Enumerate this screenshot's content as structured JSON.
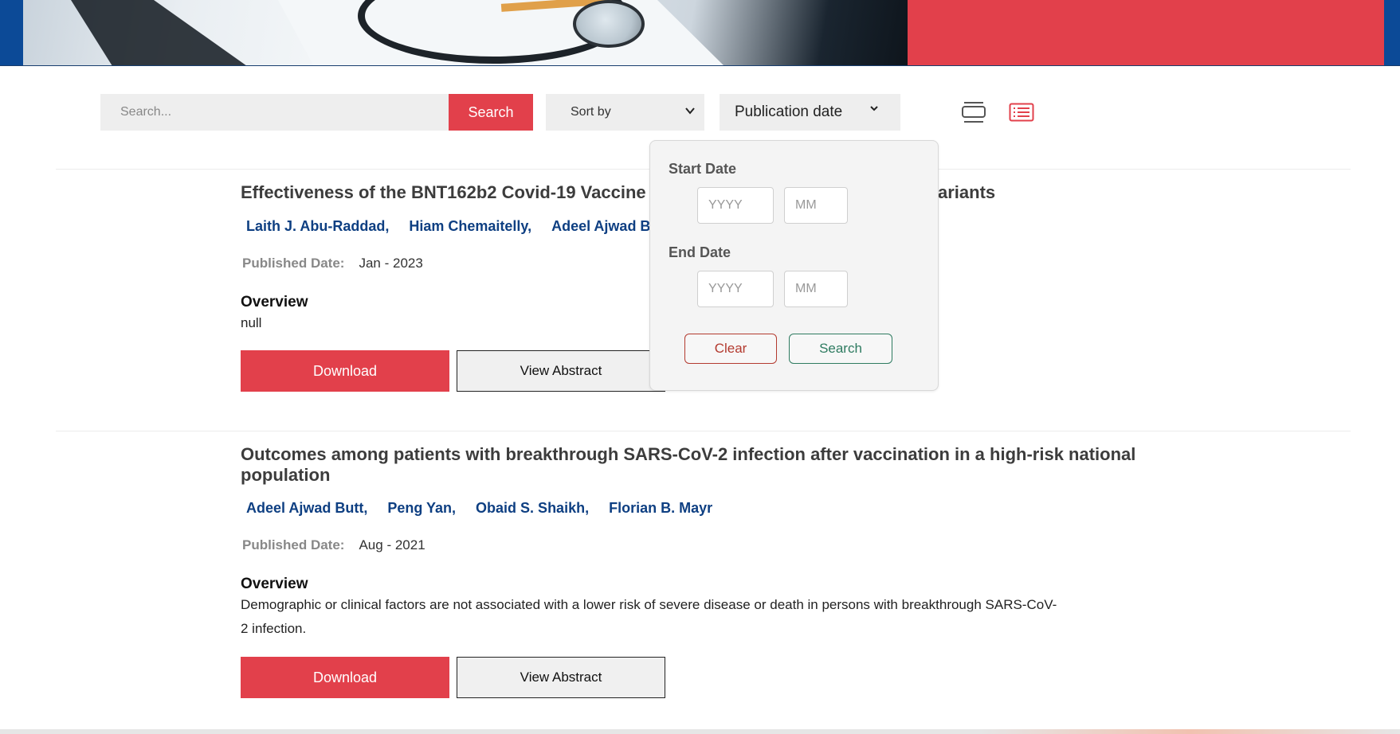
{
  "toolbar": {
    "search_placeholder": "Search...",
    "search_button": "Search",
    "sort_label": "Sort by",
    "publication_date_label": "Publication date"
  },
  "date_filter": {
    "start_label": "Start Date",
    "end_label": "End Date",
    "year_placeholder": "YYYY",
    "month_placeholder": "MM",
    "clear_label": "Clear",
    "search_label": "Search"
  },
  "articles": [
    {
      "title_visible_left": "Effectiveness of the BNT162b2 Covid-19 Vaccine",
      "title_visible_right": "ariants",
      "authors": [
        "Laith J. Abu-Raddad,",
        "Hiam Chemaitelly,",
        "Adeel Ajwad Bu"
      ],
      "published_label": "Published Date:",
      "published_value": "Jan - 2023",
      "overview_label": "Overview",
      "overview_text": "null",
      "download_label": "Download",
      "abstract_label": "View Abstract"
    },
    {
      "title_line1": "Outcomes among patients with breakthrough SARS-CoV-2 infection after vaccination in a high-risk national",
      "title_line2": "population",
      "authors": [
        "Adeel Ajwad Butt,",
        "Peng Yan,",
        "Obaid S. Shaikh,",
        "Florian B. Mayr"
      ],
      "published_label": "Published Date:",
      "published_value": "Aug - 2021",
      "overview_label": "Overview",
      "overview_line1": "Demographic or clinical factors are not associated with a lower risk of severe disease or death in persons with breakthrough SARS-CoV-",
      "overview_line2": "2 infection.",
      "download_label": "Download",
      "abstract_label": "View Abstract"
    }
  ],
  "colors": {
    "accent_red": "#e2404b",
    "author_blue": "#0e3f82",
    "clear_red": "#b33a2f",
    "search_green": "#2e7b60"
  }
}
